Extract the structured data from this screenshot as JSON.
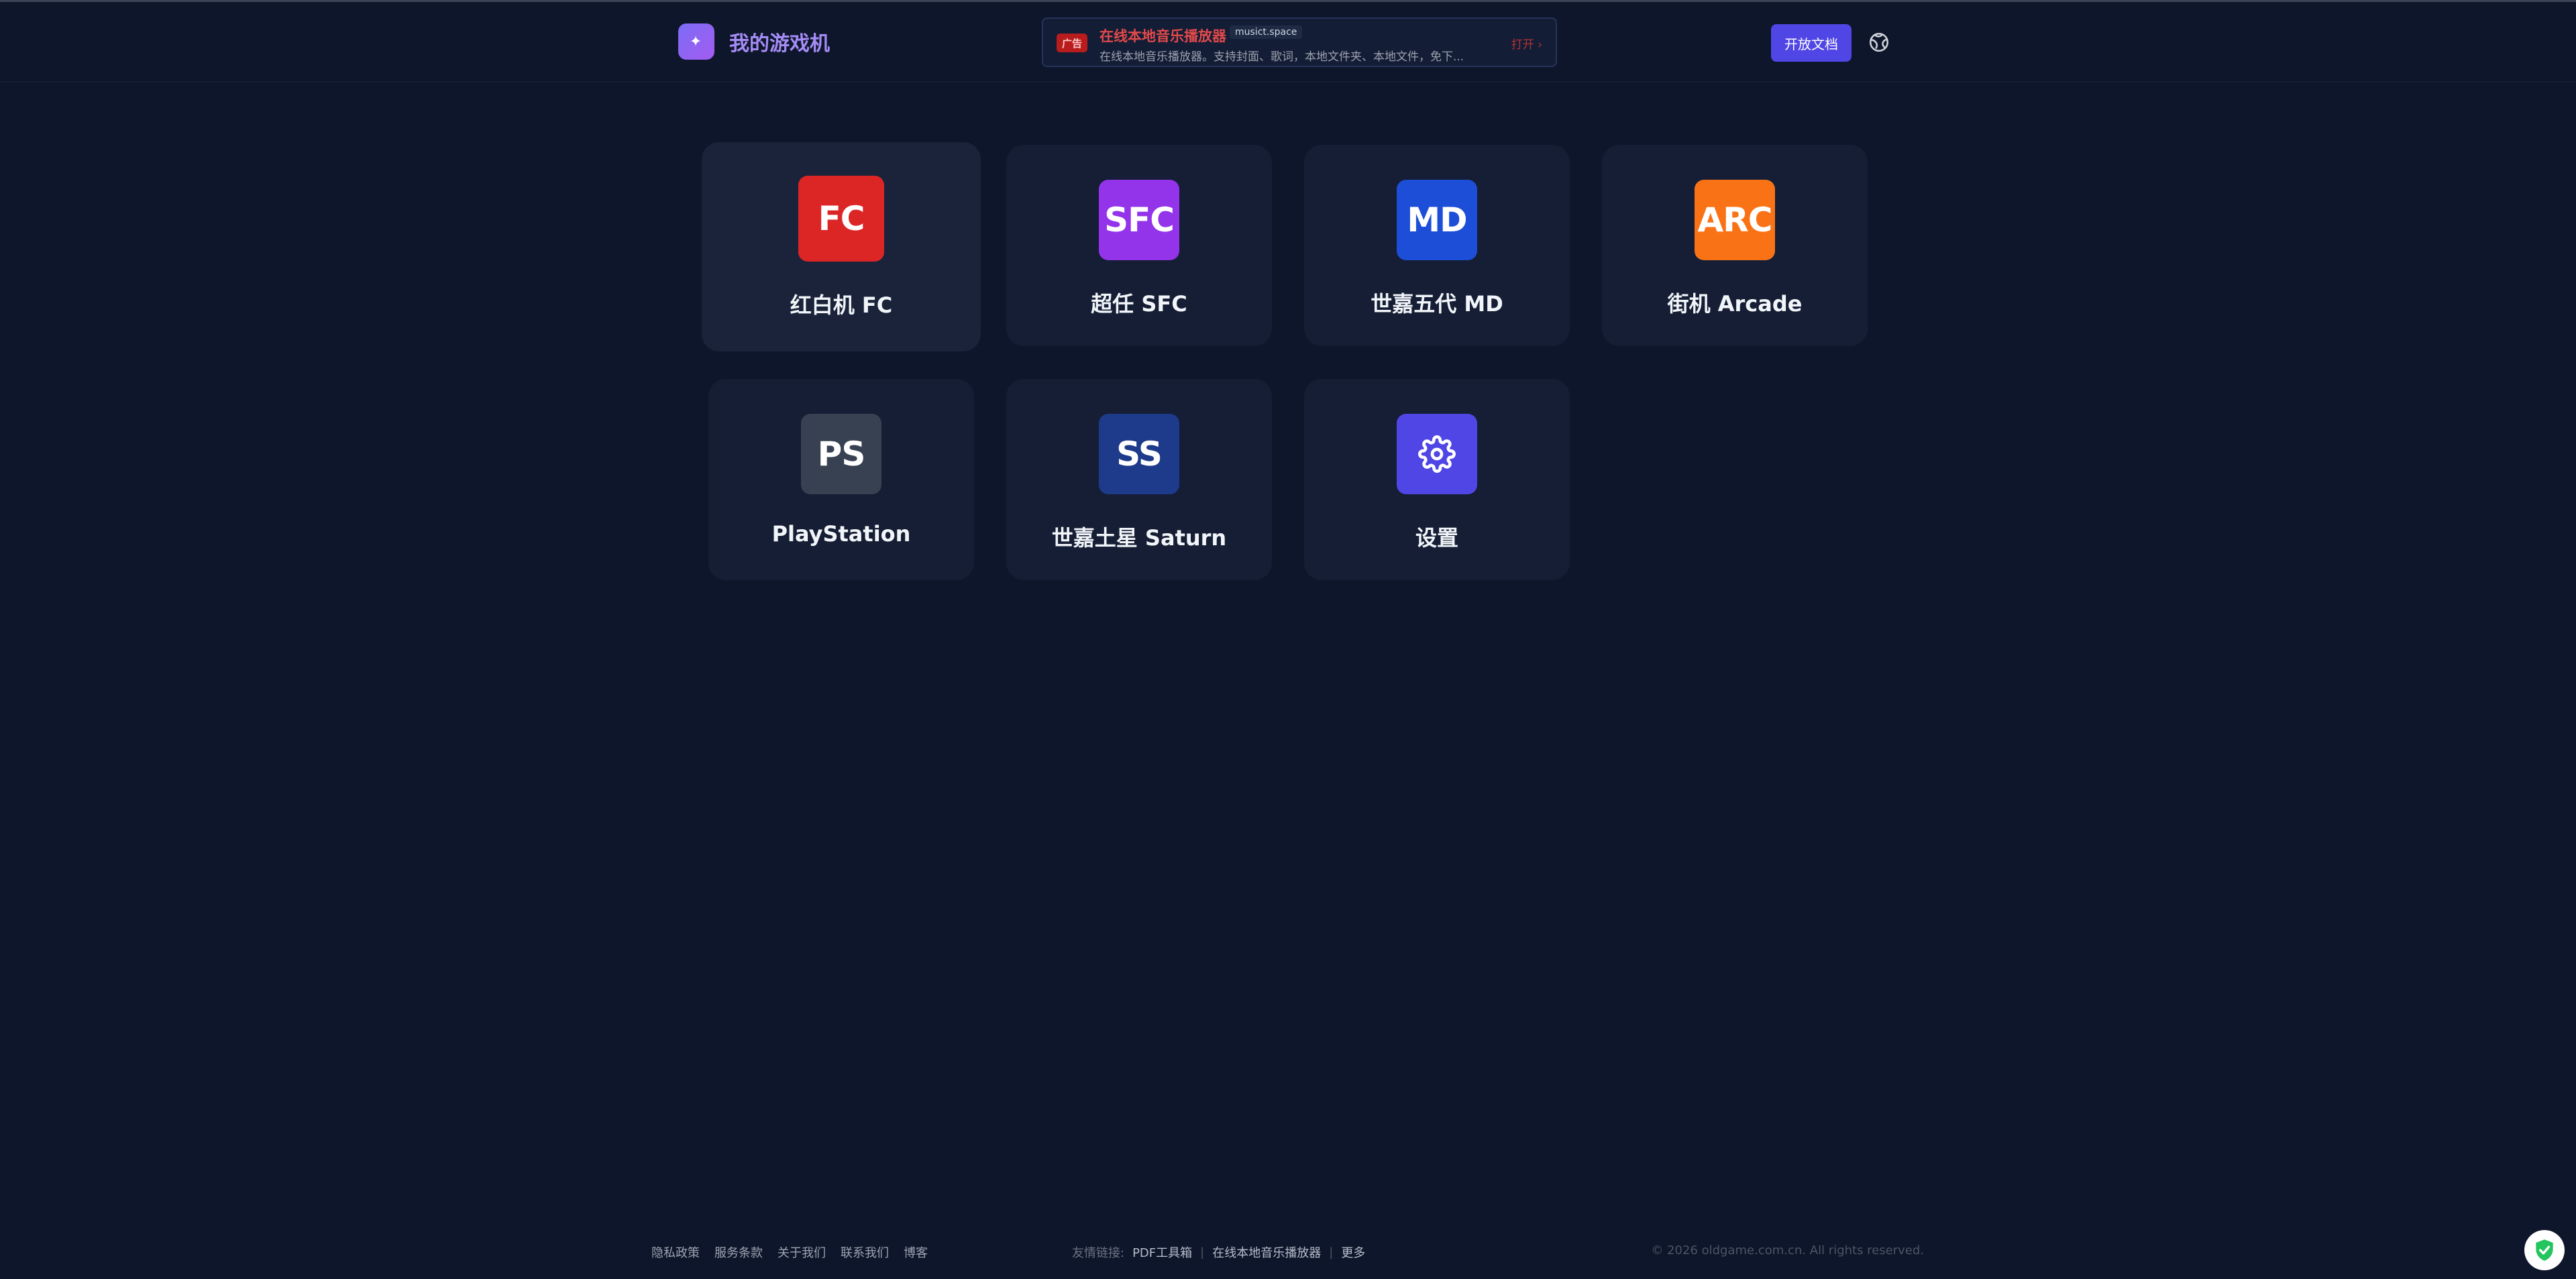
{
  "header": {
    "logo_glyph": "✦",
    "title": "我的游戏机",
    "docs_button": "开放文档"
  },
  "ad": {
    "tag": "广告",
    "title": "在线本地音乐播放器",
    "domain": "musict.space",
    "description": "在线本地音乐播放器。支持封面、歌词，本地文件夹、本地文件，免下...",
    "open": "打开 ›"
  },
  "consoles": [
    {
      "abbr": "FC",
      "label": "红白机 FC",
      "color": "#dc2626"
    },
    {
      "abbr": "SFC",
      "label": "超任 SFC",
      "color": "#9333ea"
    },
    {
      "abbr": "MD",
      "label": "世嘉五代 MD",
      "color": "#1d4ed8"
    },
    {
      "abbr": "ARC",
      "label": "街机 Arcade",
      "color": "#f97316"
    },
    {
      "abbr": "PS",
      "label": "PlayStation",
      "color": "#374151"
    },
    {
      "abbr": "SS",
      "label": "世嘉土星 Saturn",
      "color": "#1e3a8a"
    },
    {
      "abbr": "",
      "label": "设置",
      "color": "#4f46e5",
      "icon": "gear-icon"
    }
  ],
  "footer": {
    "links": [
      "隐私政策",
      "服务条款",
      "关于我们",
      "联系我们",
      "博客"
    ],
    "friends_label": "友情链接:",
    "friends": [
      "PDF工具箱",
      "在线本地音乐播放器",
      "更多"
    ],
    "separator": "|",
    "copyright": "© 2026 oldgame.com.cn. All rights reserved."
  }
}
